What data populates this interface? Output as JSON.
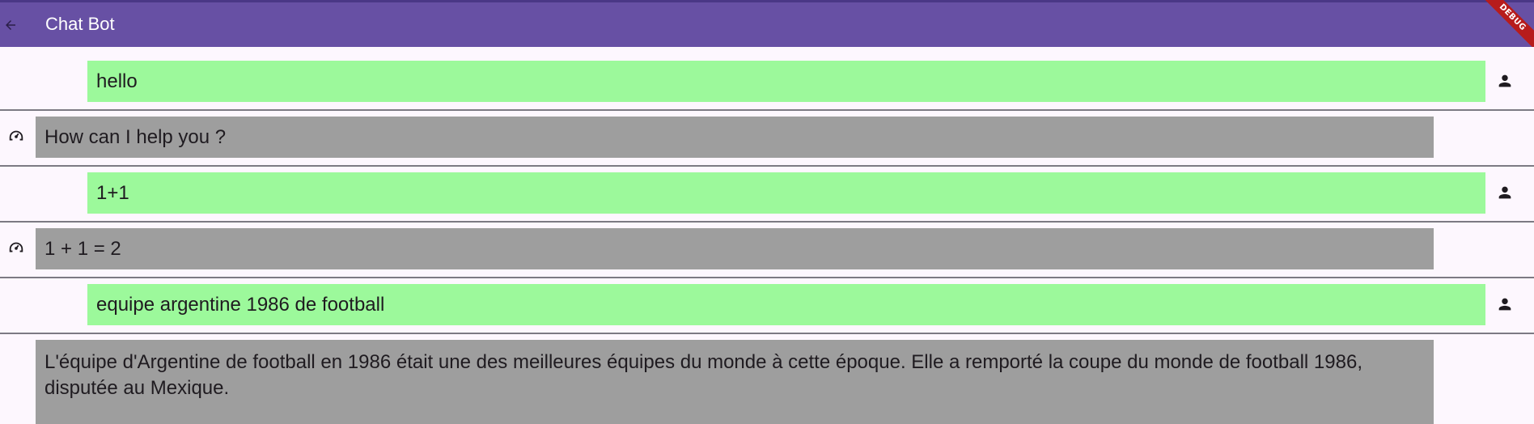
{
  "app_bar": {
    "title": "Chat Bot",
    "back_icon": "arrow-back-icon",
    "debug_banner": "DEBUG",
    "color": "#6750a4"
  },
  "colors": {
    "user_bubble": "#9cf99b",
    "bot_bubble": "#9e9e9e",
    "background": "#fdf7fe",
    "divider": "#7c7a83"
  },
  "messages": [
    {
      "sender": "user",
      "text": "hello",
      "icon": "person-icon"
    },
    {
      "sender": "bot",
      "text": "How can I help you ?",
      "icon": "bot-icon"
    },
    {
      "sender": "user",
      "text": "1+1",
      "icon": "person-icon"
    },
    {
      "sender": "bot",
      "text": "1 + 1 = 2",
      "icon": "bot-icon"
    },
    {
      "sender": "user",
      "text": "equipe argentine 1986 de football",
      "icon": "person-icon"
    },
    {
      "sender": "bot",
      "text": "L'équipe d'Argentine de football en 1986 était une des meilleures équipes du monde à cette époque. Elle a remporté la coupe du monde de football 1986, disputée au Mexique."
    }
  ]
}
